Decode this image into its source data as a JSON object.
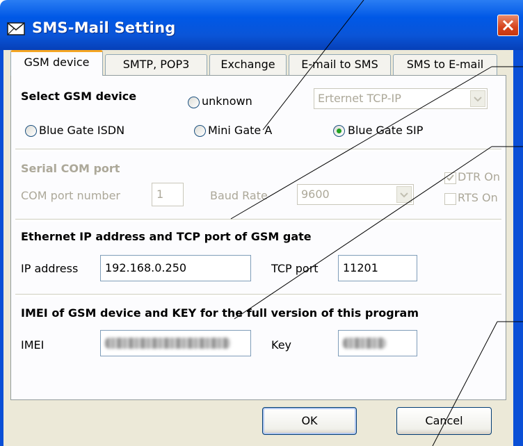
{
  "window": {
    "title": "SMS-Mail Setting",
    "icon": "envelope-icon",
    "close_icon": "close-icon"
  },
  "tabs": [
    "GSM device",
    "SMTP, POP3",
    "Exchange",
    "E-mail to SMS",
    "SMS to E-mail"
  ],
  "gsm_device": {
    "heading": "Select GSM device",
    "options": {
      "unknown": "unknown",
      "blue_gate_isdn": "Blue Gate ISDN",
      "mini_gate_a": "Mini Gate A",
      "blue_gate_sip": "Blue Gate SIP"
    },
    "selected": "Blue Gate SIP",
    "connection_select": "Erternet TCP-IP"
  },
  "serial": {
    "heading": "Serial COM port",
    "com_port_label": "COM port number",
    "com_port_value": "1",
    "baud_label": "Baud Rate",
    "baud_value": "9600",
    "dtr_label": "DTR On",
    "dtr_checked": true,
    "rts_label": "RTS On",
    "rts_checked": false
  },
  "ethernet": {
    "heading": "Ethernet IP address and TCP port of GSM gate",
    "ip_label": "IP address",
    "ip_value": "192.168.0.250",
    "port_label": "TCP port",
    "port_value": "11201"
  },
  "imei": {
    "heading": "IMEI of GSM device and KEY for the full version of this program",
    "imei_label": "IMEI",
    "key_label": "Key"
  },
  "buttons": {
    "ok": "OK",
    "cancel": "Cancel"
  },
  "colors": {
    "title_bar": "#0058e6",
    "close_button": "#d6431d",
    "tab_highlight": "#f5a623",
    "radio_selected": "#21a121"
  }
}
